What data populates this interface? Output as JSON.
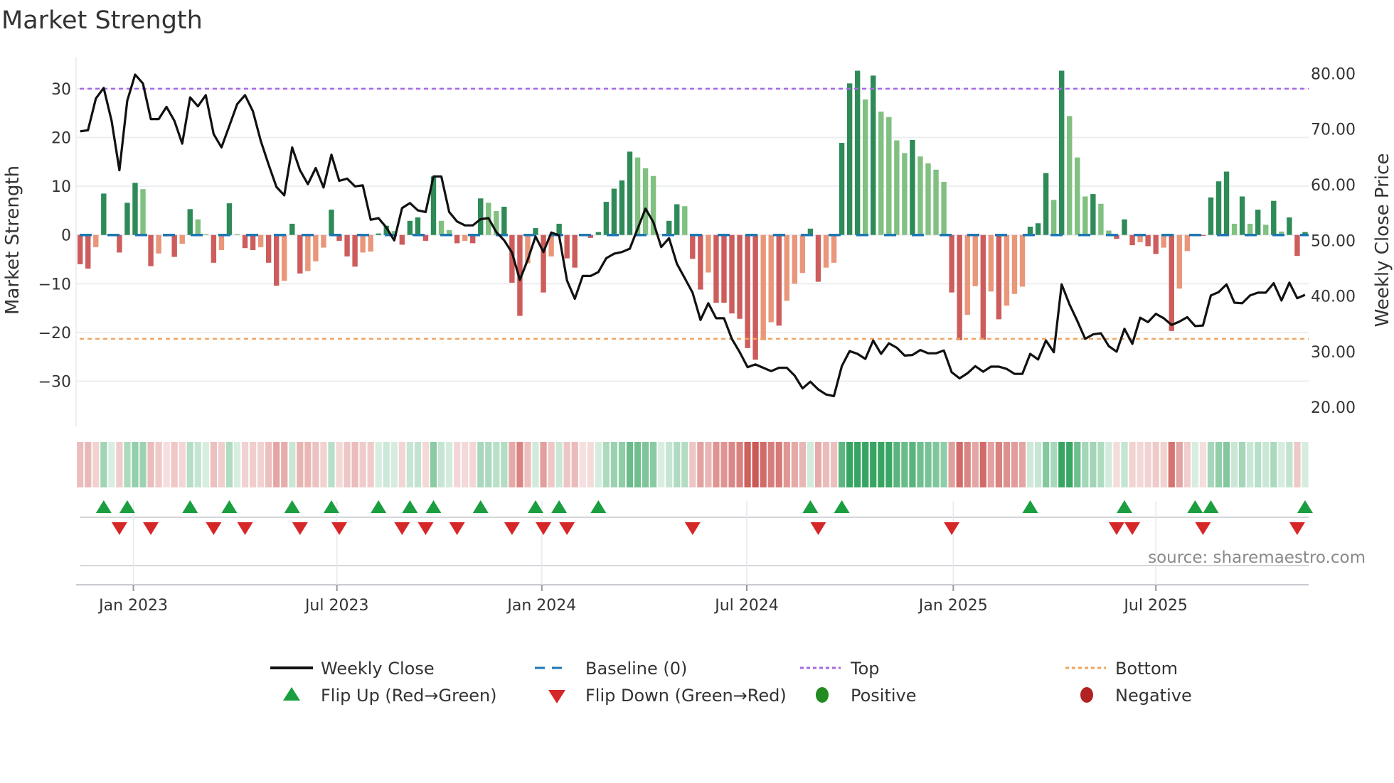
{
  "title": "Market Strength",
  "source": "source: sharemaestro.com",
  "colors": {
    "bar_strong_pos": "#2e8b57",
    "bar_weak_pos": "#80c080",
    "bar_strong_neg": "#cd5c5c",
    "bar_weak_neg": "#e9967a",
    "close_line": "#111111",
    "baseline": "#1f77b4",
    "top": "#a569e0",
    "bottom": "#f0a560",
    "flip_up": "#1a9e3f",
    "flip_down": "#d62728",
    "positive": "#228b22",
    "negative": "#b22222",
    "strip_pos": "#2ca05a",
    "strip_neg": "#c9504d"
  },
  "chart_data": {
    "type": "bar",
    "title": "Market Strength",
    "ylabel": "Market Strength",
    "y2label": "Weekly Close Price",
    "interval": "weekly",
    "ylim": [
      -35,
      36
    ],
    "y2lim": [
      18,
      82
    ],
    "yticks": [
      "30",
      "20",
      "10",
      "0",
      "−10",
      "−20",
      "−30"
    ],
    "ytick_values": [
      30,
      20,
      10,
      0,
      -10,
      -20,
      -30
    ],
    "y2ticks": [
      "80.00",
      "70.00",
      "60.00",
      "50.00",
      "40.00",
      "30.00",
      "20.00"
    ],
    "y2tick_values": [
      80,
      70,
      60,
      50,
      40,
      30,
      20
    ],
    "xticks": [
      {
        "label": "Jan 2023",
        "week": 6.78
      },
      {
        "label": "Jul 2023",
        "week": 32.7
      },
      {
        "label": "Jan 2024",
        "week": 58.8
      },
      {
        "label": "Jul 2024",
        "week": 84.9
      },
      {
        "label": "Jan 2025",
        "week": 111.2
      },
      {
        "label": "Jul 2025",
        "week": 137.0
      }
    ],
    "grid": true,
    "top_level": 30,
    "bottom_level": -21.3,
    "baseline_level": 0,
    "strength": [
      -6.0,
      -6.9,
      -2.5,
      8.5,
      0.1,
      -3.6,
      6.6,
      10.7,
      9.4,
      -6.4,
      -3.8,
      -0.3,
      -4.5,
      -1.8,
      5.3,
      3.2,
      0.2,
      -5.7,
      -3.1,
      6.5,
      0.2,
      -2.7,
      -3.1,
      -2.5,
      -5.7,
      -10.4,
      -9.4,
      2.3,
      -7.9,
      -7.4,
      -5.4,
      -2.6,
      5.2,
      -1.2,
      -4.4,
      -6.5,
      -3.6,
      -3.4,
      0.3,
      1.9,
      0.8,
      -2.0,
      2.9,
      3.6,
      -1.2,
      12.0,
      2.9,
      1.0,
      -1.7,
      -1.2,
      -1.7,
      7.5,
      6.6,
      4.9,
      5.8,
      -9.8,
      -16.6,
      -5.8,
      1.4,
      -11.8,
      -4.4,
      2.3,
      -4.8,
      -6.7,
      -0.1,
      -0.6,
      0.6,
      6.8,
      9.5,
      11.2,
      17.1,
      15.9,
      13.7,
      12.1,
      0.1,
      2.9,
      6.3,
      5.9,
      -4.9,
      -11.2,
      -7.7,
      -13.9,
      -13.9,
      -16.1,
      -17.2,
      -23.2,
      -25.6,
      -21.6,
      -17.9,
      -18.6,
      -13.5,
      -10.0,
      -7.8,
      1.3,
      -9.6,
      -6.7,
      -5.7,
      18.9,
      31.1,
      33.7,
      27.8,
      32.7,
      25.3,
      24.2,
      19.4,
      16.8,
      19.5,
      16.1,
      14.7,
      13.4,
      10.9,
      -11.8,
      -21.6,
      -16.4,
      -10.5,
      -21.5,
      -11.6,
      -17.3,
      -14.5,
      -12.1,
      -10.6,
      1.7,
      2.4,
      12.7,
      7.2,
      33.7,
      24.4,
      15.9,
      7.9,
      8.4,
      6.4,
      0.9,
      -0.8,
      3.2,
      -2.1,
      -1.5,
      -2.3,
      -3.9,
      -2.6,
      -19.7,
      -11.0,
      -3.3,
      0.2,
      -0.2,
      7.7,
      11.0,
      13.0,
      2.3,
      7.9,
      2.3,
      5.2,
      2.1,
      7.0,
      0.7,
      3.6,
      -4.3,
      0.6
    ],
    "weekly_close": [
      69.6,
      69.8,
      75.5,
      77.4,
      71.5,
      62.6,
      75.1,
      79.8,
      78.2,
      71.8,
      71.8,
      74.0,
      71.5,
      67.4,
      75.7,
      74.1,
      76.1,
      69.1,
      66.7,
      70.6,
      74.5,
      76.1,
      73.2,
      67.9,
      63.6,
      59.6,
      58.1,
      66.7,
      62.6,
      60.1,
      63.0,
      59.5,
      65.4,
      60.7,
      61.1,
      59.7,
      59.9,
      53.7,
      54.0,
      52.3,
      50.0,
      55.8,
      56.7,
      55.4,
      55.1,
      61.5,
      61.5,
      55.1,
      53.4,
      52.7,
      52.7,
      53.8,
      54.0,
      51.5,
      50.0,
      47.8,
      42.9,
      46.5,
      50.7,
      47.9,
      51.4,
      50.9,
      42.8,
      39.5,
      43.6,
      43.6,
      44.3,
      46.8,
      47.6,
      47.9,
      48.5,
      52.1,
      55.7,
      53.3,
      48.8,
      50.4,
      45.8,
      43.2,
      40.6,
      35.7,
      38.7,
      36.0,
      36.0,
      32.3,
      29.9,
      27.2,
      27.7,
      27.1,
      26.5,
      27.1,
      27.1,
      25.7,
      23.4,
      24.6,
      23.2,
      22.3,
      22.0,
      27.4,
      30.1,
      29.6,
      28.7,
      32.0,
      29.6,
      31.5,
      30.7,
      29.3,
      29.4,
      30.3,
      29.7,
      29.7,
      30.2,
      26.3,
      25.2,
      26.1,
      27.4,
      26.4,
      27.3,
      27.3,
      26.9,
      26.0,
      26.0,
      29.6,
      28.6,
      32.0,
      29.9,
      42.1,
      38.5,
      35.5,
      32.3,
      33.1,
      33.3,
      31.0,
      30.0,
      34.1,
      31.4,
      36.1,
      35.3,
      36.8,
      36.0,
      34.8,
      35.4,
      36.2,
      34.6,
      34.7,
      40.1,
      40.7,
      42.1,
      38.8,
      38.7,
      40.1,
      40.6,
      40.6,
      42.3,
      39.2,
      42.4,
      39.6,
      40.2
    ],
    "legend": [
      {
        "label": "Weekly Close",
        "symbol": "line"
      },
      {
        "label": "Baseline (0)",
        "symbol": "dashed-line"
      },
      {
        "label": "Top",
        "symbol": "dotted-line"
      },
      {
        "label": "Bottom",
        "symbol": "dotted-line"
      },
      {
        "label": "Flip Up (Red→Green)",
        "symbol": "triangle-up"
      },
      {
        "label": "Flip Down (Green→Red)",
        "symbol": "triangle-down"
      },
      {
        "label": "Positive",
        "symbol": "circle"
      },
      {
        "label": "Negative",
        "symbol": "circle"
      }
    ],
    "legend_position": "bottom"
  }
}
